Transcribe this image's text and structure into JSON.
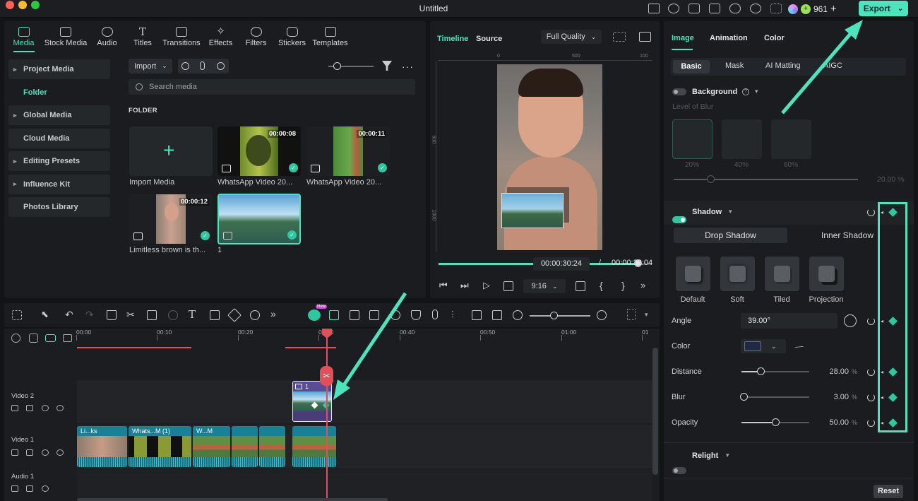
{
  "window": {
    "title": "Untitled"
  },
  "credits": {
    "count": "961",
    "plus": "+"
  },
  "export": {
    "label": "Export",
    "chevron": "⌄"
  },
  "media_tabs": [
    "Media",
    "Stock Media",
    "Audio",
    "Titles",
    "Transitions",
    "Effects",
    "Filters",
    "Stickers",
    "Templates"
  ],
  "sidebar": [
    "Project Media",
    "Folder",
    "Global Media",
    "Cloud Media",
    "Editing Presets",
    "Influence Kit",
    "Photos Library"
  ],
  "media_toolbar": {
    "import_label": "Import",
    "search_placeholder": "Search media",
    "folder_heading": "FOLDER"
  },
  "media_items": [
    {
      "name": "Import Media",
      "duration": ""
    },
    {
      "name": "WhatsApp Video 20...",
      "duration": "00:00:08"
    },
    {
      "name": "WhatsApp Video 20...",
      "duration": "00:00:11"
    },
    {
      "name": "Limitless brown is th...",
      "duration": "00:00:12"
    },
    {
      "name": "1",
      "duration": ""
    }
  ],
  "player": {
    "tab_timeline": "Timeline",
    "tab_source": "Source",
    "quality": "Full Quality",
    "current_time": "00:00:30:24",
    "separator": "/",
    "total_time": "00:00:32:04",
    "ratio": "9:16",
    "ruler_top": [
      "0",
      "500",
      "100"
    ],
    "ruler_left": [
      "500",
      "1000"
    ],
    "progress": 0.94
  },
  "inspector": {
    "tabs": [
      "Image",
      "Animation",
      "Color"
    ],
    "subtabs": [
      "Basic",
      "Mask",
      "AI Matting",
      "AIGC"
    ],
    "background": {
      "label": "Background",
      "sub": "Level of Blur",
      "options": [
        "20%",
        "40%",
        "60%"
      ],
      "value": "20.00",
      "unit": "%",
      "level": 0.2
    },
    "shadow": {
      "label": "Shadow",
      "types": [
        "Drop Shadow",
        "Inner Shadow"
      ],
      "presets": [
        "Default",
        "Soft",
        "Tiled",
        "Projection"
      ],
      "angle": {
        "label": "Angle",
        "value": "39.00°"
      },
      "color": {
        "label": "Color",
        "value": "#1e2a44"
      },
      "distance": {
        "label": "Distance",
        "value": "28.00",
        "unit": "%",
        "level": 0.28
      },
      "blur": {
        "label": "Blur",
        "value": "3.00",
        "unit": "%",
        "level": 0.03
      },
      "opacity": {
        "label": "Opacity",
        "value": "50.00",
        "unit": "%",
        "level": 0.5
      }
    },
    "relight": {
      "label": "Relight"
    },
    "reset": "Reset"
  },
  "timeline": {
    "ruler": [
      "00:00",
      "00:10",
      "00:20",
      "00:30",
      "00:40",
      "00:50",
      "01:00",
      "01"
    ],
    "tracks": [
      "Video 2",
      "Video 1",
      "Audio 1"
    ],
    "clips_video1": [
      "Li...ks",
      "Whats...M (1)",
      "W...M",
      "",
      "",
      ""
    ],
    "clip_video2": "1",
    "new_badge": "New"
  },
  "colors": {
    "accent": "#4de3bd",
    "playhead": "#e04f5a"
  }
}
